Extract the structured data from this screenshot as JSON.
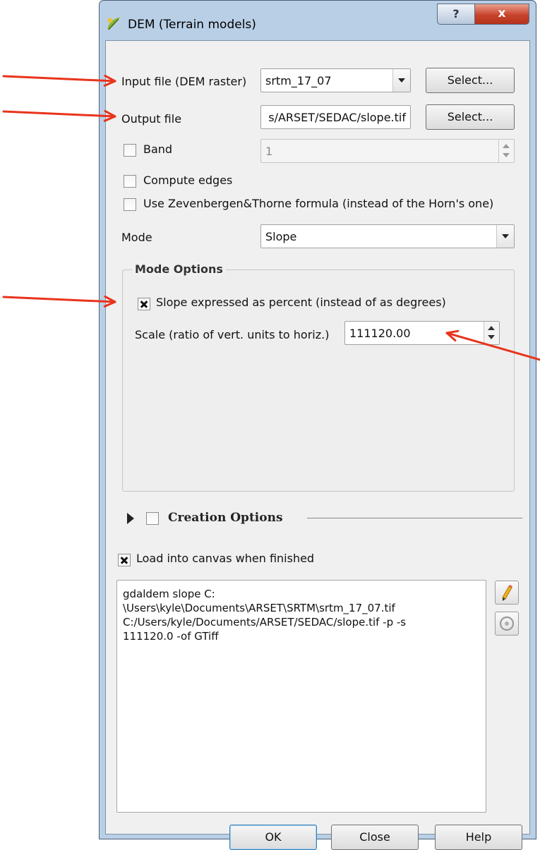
{
  "window": {
    "title": "DEM (Terrain models)",
    "help_label": "?",
    "close_label": "x"
  },
  "input_file": {
    "label": "Input file (DEM raster)",
    "value": "srtm_17_07",
    "select_label": "Select..."
  },
  "output_file": {
    "label": "Output file",
    "value": "s/ARSET/SEDAC/slope.tif",
    "select_label": "Select..."
  },
  "band": {
    "label": "Band",
    "checked": false,
    "value": "1"
  },
  "compute_edges": {
    "label": "Compute edges",
    "checked": false
  },
  "zevenbergen": {
    "label": "Use Zevenbergen&Thorne formula (instead of the Horn's one)",
    "checked": false
  },
  "mode": {
    "label": "Mode",
    "value": "Slope"
  },
  "mode_options": {
    "title": "Mode Options",
    "slope_percent_label": "Slope expressed as percent (instead of as degrees)",
    "slope_percent_checked": true,
    "scale_label": "Scale (ratio of vert. units to horiz.)",
    "scale_value": "111120.00"
  },
  "creation_options": {
    "title": "Creation Options"
  },
  "load_canvas": {
    "label": "Load into canvas when finished",
    "checked": true
  },
  "command": {
    "lines": [
      "gdaldem slope C:",
      "\\Users\\kyle\\Documents\\ARSET\\SRTM\\srtm_17_07.tif",
      "C:/Users/kyle/Documents/ARSET/SEDAC/slope.tif -p -s",
      "111120.0 -of GTiff"
    ]
  },
  "buttons": {
    "ok": "OK",
    "close": "Close",
    "help": "Help"
  },
  "annotation_color": "#e8341c"
}
